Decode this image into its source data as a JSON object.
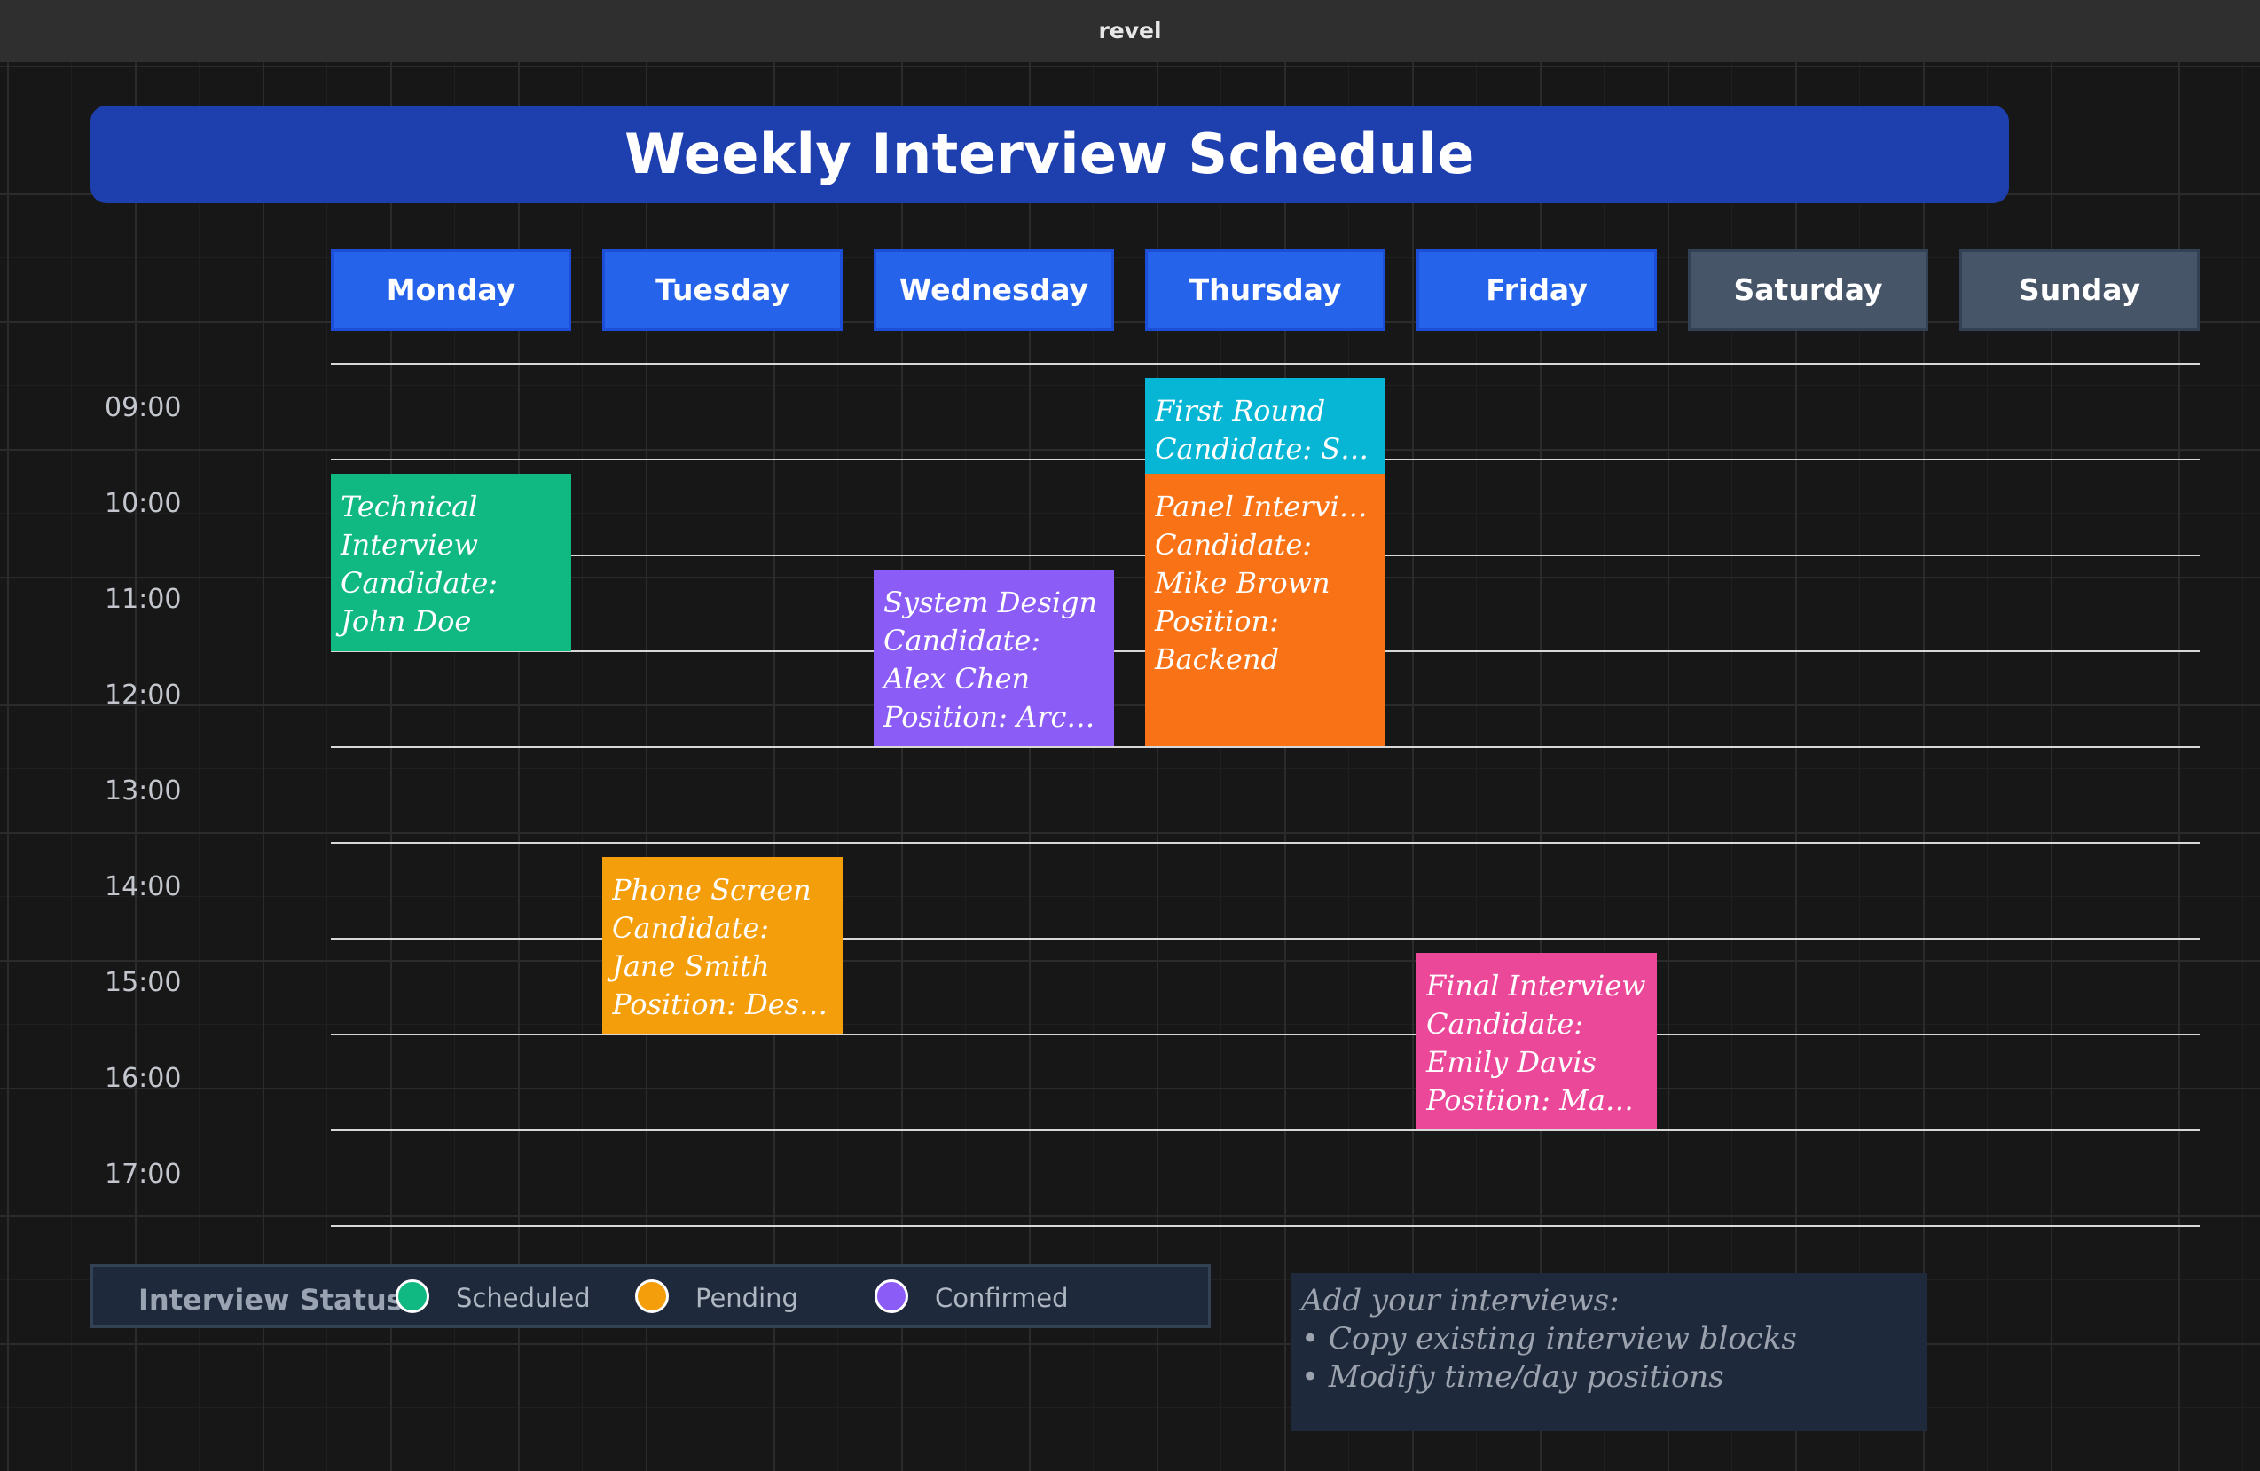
{
  "window": {
    "title": "revel"
  },
  "header": {
    "title": "Weekly Interview Schedule"
  },
  "days": [
    "Monday",
    "Tuesday",
    "Wednesday",
    "Thursday",
    "Friday",
    "Saturday",
    "Sunday"
  ],
  "times": [
    "09:00",
    "10:00",
    "11:00",
    "12:00",
    "13:00",
    "14:00",
    "15:00",
    "16:00",
    "17:00"
  ],
  "events": [
    {
      "title": "Technical Interview",
      "candidate": "Candidate: John Doe",
      "position": "",
      "day": "Monday",
      "color": "#10b981"
    },
    {
      "title": "Phone Screen",
      "candidate": "Candidate: Jane Smith",
      "position": "Position: Desi…",
      "day": "Tuesday",
      "color": "#f59e0b"
    },
    {
      "title": "System Design",
      "candidate": "Candidate: Alex Chen",
      "position": "Position: Arch…",
      "day": "Wednesday",
      "color": "#8b5cf6"
    },
    {
      "title": "First Round",
      "candidate": "Candidate: Sarah",
      "position": "",
      "day": "Thursday",
      "color": "#06b6d4"
    },
    {
      "title": "Panel Interview",
      "candidate": "Candidate: Mike Brown",
      "position": "Position: Backend",
      "day": "Thursday",
      "color": "#f97316"
    },
    {
      "title": "Final Interview",
      "candidate": "Candidate: Emily Davis",
      "position": "Position: Man…",
      "day": "Friday",
      "color": "#ec4899"
    }
  ],
  "legend": {
    "title": "Interview Status:",
    "items": [
      {
        "label": "Scheduled",
        "color": "#10b981"
      },
      {
        "label": "Pending",
        "color": "#f59e0b"
      },
      {
        "label": "Confirmed",
        "color": "#8b5cf6"
      }
    ]
  },
  "notes": {
    "title": "Add your interviews:",
    "items": [
      "• Copy existing interview blocks",
      "• Modify time/day positions"
    ]
  }
}
